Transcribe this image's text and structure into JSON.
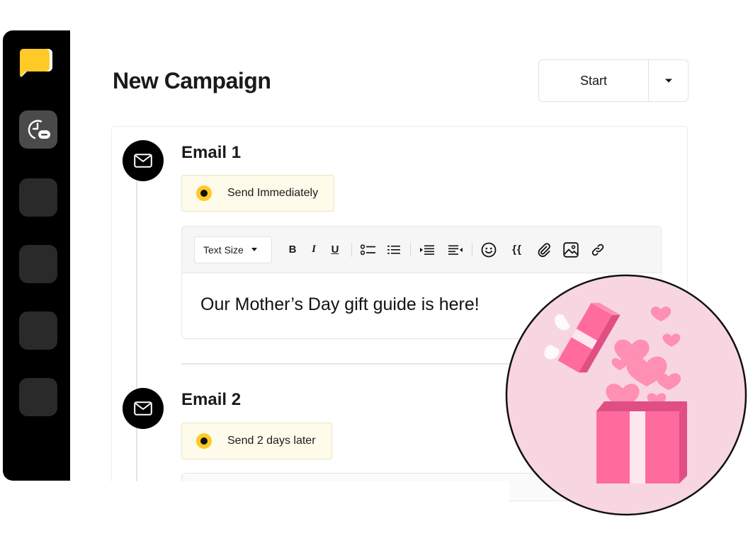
{
  "header": {
    "title": "New Campaign",
    "start_label": "Start"
  },
  "emails": [
    {
      "title": "Email 1",
      "schedule": "Send Immediately"
    },
    {
      "title": "Email 2",
      "schedule": "Send 2 days later"
    }
  ],
  "editor": {
    "text_size_label": "Text Size",
    "bold_label": "B",
    "italic_label": "I",
    "underline_label": "U",
    "variables_label": "{{",
    "content": "Our Mother’s Day gift guide is here!"
  },
  "icons": {
    "sidebar": [
      "chat-logo-icon",
      "clock-minus-icon"
    ],
    "timeline": "envelope-icon",
    "toolbar": [
      "bulleted-list-icon",
      "numbered-list-icon",
      "indent-icon",
      "outdent-icon",
      "emoji-icon",
      "attachment-icon",
      "image-icon",
      "link-icon"
    ],
    "illustration": "gift-box-hearts"
  },
  "colors": {
    "accent_yellow": "#ffc928",
    "pill_bg": "#fefbeb",
    "illustration_bg": "#f7d6e1",
    "gift_pink": "#ff6b9d"
  }
}
